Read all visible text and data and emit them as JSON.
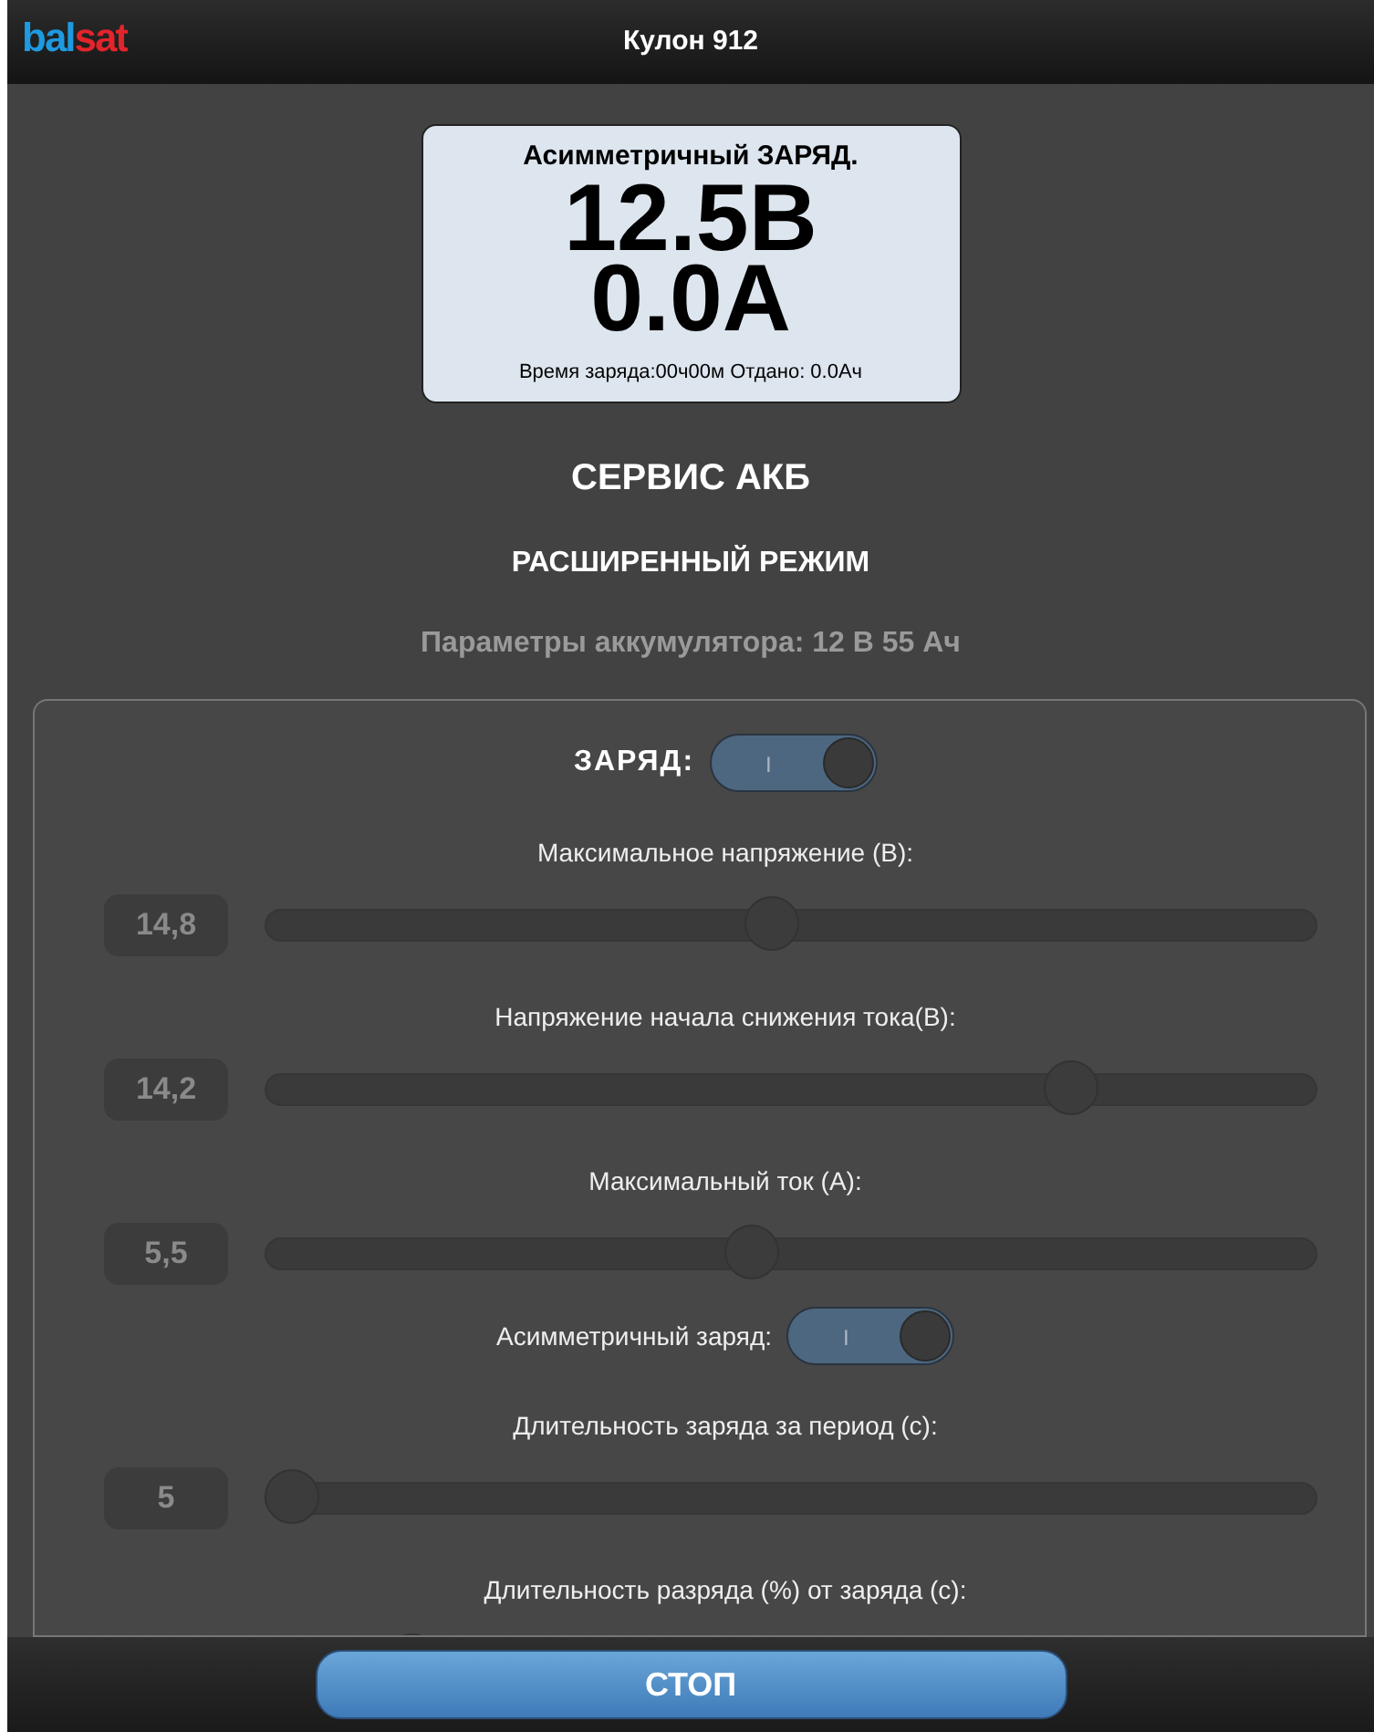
{
  "header": {
    "logo": "balsat",
    "title": "Кулон 912"
  },
  "display": {
    "mode": "Асимметричный ЗАРЯД.",
    "voltage": "12.5В",
    "current": "0.0А",
    "footer": "Время заряда:00ч00м Отдано: 0.0Ач"
  },
  "section_title": "СЕРВИС АКБ",
  "subtitle": "РАСШИРЕННЫЙ РЕЖИМ",
  "battery_params": "Параметры аккумулятора: 12 В 55 Ач",
  "panel": {
    "charge_switch": {
      "label": "ЗАРЯД:",
      "on": true,
      "mark": "I"
    },
    "items": [
      {
        "kind": "slider",
        "label": "Максимальное напряжение (В):",
        "value": "14,8",
        "level": 0.48
      },
      {
        "kind": "slider",
        "label": "Напряжение начала снижения тока(В):",
        "value": "14,2",
        "level": 0.78
      },
      {
        "kind": "slider",
        "label": "Максимальный ток (А):",
        "value": "5,5",
        "level": 0.46
      },
      {
        "kind": "toggle",
        "label": "Асимметричный заряд:",
        "on": true,
        "mark": "I"
      },
      {
        "kind": "slider",
        "label": "Длительность заряда за период (с):",
        "value": "5",
        "level": 0
      },
      {
        "kind": "slider",
        "label": "Длительность разряда (%) от заряда (с):",
        "level": 0.12
      }
    ]
  },
  "stop_button": "СТОП"
}
